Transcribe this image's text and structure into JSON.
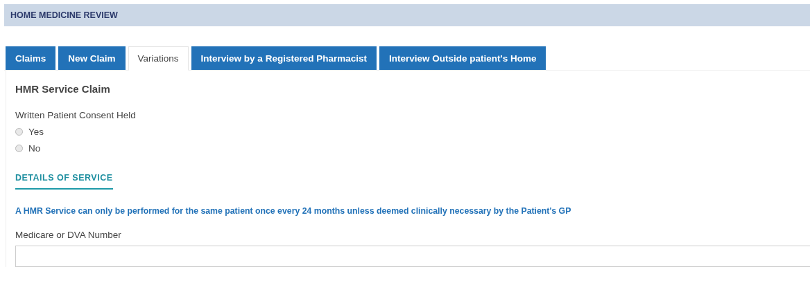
{
  "page_title": "HOME MEDICINE REVIEW",
  "tabs": [
    {
      "label": "Claims",
      "selected": false
    },
    {
      "label": "New Claim",
      "selected": false
    },
    {
      "label": "Variations",
      "selected": true
    },
    {
      "label": "Interview by a Registered Pharmacist",
      "selected": false
    },
    {
      "label": "Interview Outside patient's Home",
      "selected": false
    }
  ],
  "form_title": "HMR Service Claim",
  "consent": {
    "label": "Written Patient Consent Held",
    "options": [
      {
        "label": "Yes",
        "selected": false
      },
      {
        "label": "No",
        "selected": false
      }
    ]
  },
  "section_heading": "DETAILS OF SERVICE",
  "notice": "A HMR Service can only be performed for the same patient once every 24 months unless deemed clinically necessary by the Patient's GP",
  "medicare_field": {
    "label": "Medicare or DVA Number"
  }
}
